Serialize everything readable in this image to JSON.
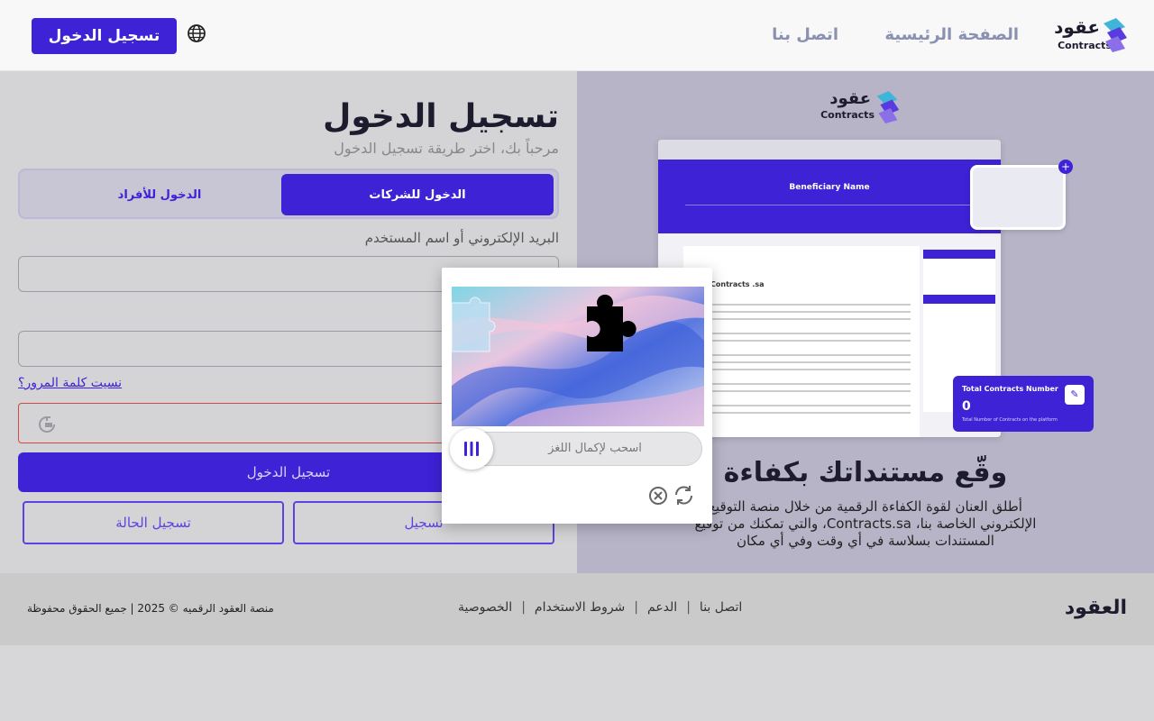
{
  "header": {
    "logo_ar": "عقود",
    "logo_en": "Contracts",
    "nav_home": "الصفحة الرئيسية",
    "nav_contact": "اتصل بنا",
    "login_button": "تسجيل الدخول",
    "globe_icon": "globe-icon"
  },
  "promo": {
    "logo_ar": "عقود",
    "logo_en": "Contracts",
    "mock_title": "Beneficiary Name",
    "mock_doc_heading": "Contracts .sa",
    "total_label": "Total Contracts Number",
    "total_value": "0",
    "total_sub": "Total Number of Contracts on the platform",
    "title": "وقّع مستنداتك بكفاءة",
    "description": "أطلق العنان لقوة الكفاءة الرقمية من خلال منصة التوقيع الإلكتروني الخاصة بنا، Contracts.sa، والتي تمكنك من توقيع المستندات بسلاسة في أي وقت وفي أي مكان"
  },
  "login": {
    "title": "تسجيل الدخول",
    "subtitle": "مرحباً بك، اختر طريقة تسجيل الدخول",
    "tab_company": "الدخول للشركات",
    "tab_individual": "الدخول للأفراد",
    "email_label": "البريد الإلكتروني أو اسم المستخدم",
    "forgot": "نسيت كلمة المرور؟",
    "submit": "تسجيل الدخول",
    "register": "تسجيل",
    "register_status": "تسجيل الحالة"
  },
  "captcha": {
    "slider_text": "اسحب لإكمال اللغز",
    "handle_icon": "drag-handle-icon",
    "close_icon": "close-icon",
    "refresh_icon": "refresh-icon"
  },
  "footer": {
    "brand": "العقود",
    "links": [
      "اتصل بنا",
      "الدعم",
      "شروط الاستخدام",
      "الخصوصية"
    ],
    "copyright": "منصة العقود الرقميه © 2025 | جميع الحقوق محفوظة"
  },
  "colors": {
    "primary": "#3d22d6",
    "error_border": "#d04848"
  }
}
